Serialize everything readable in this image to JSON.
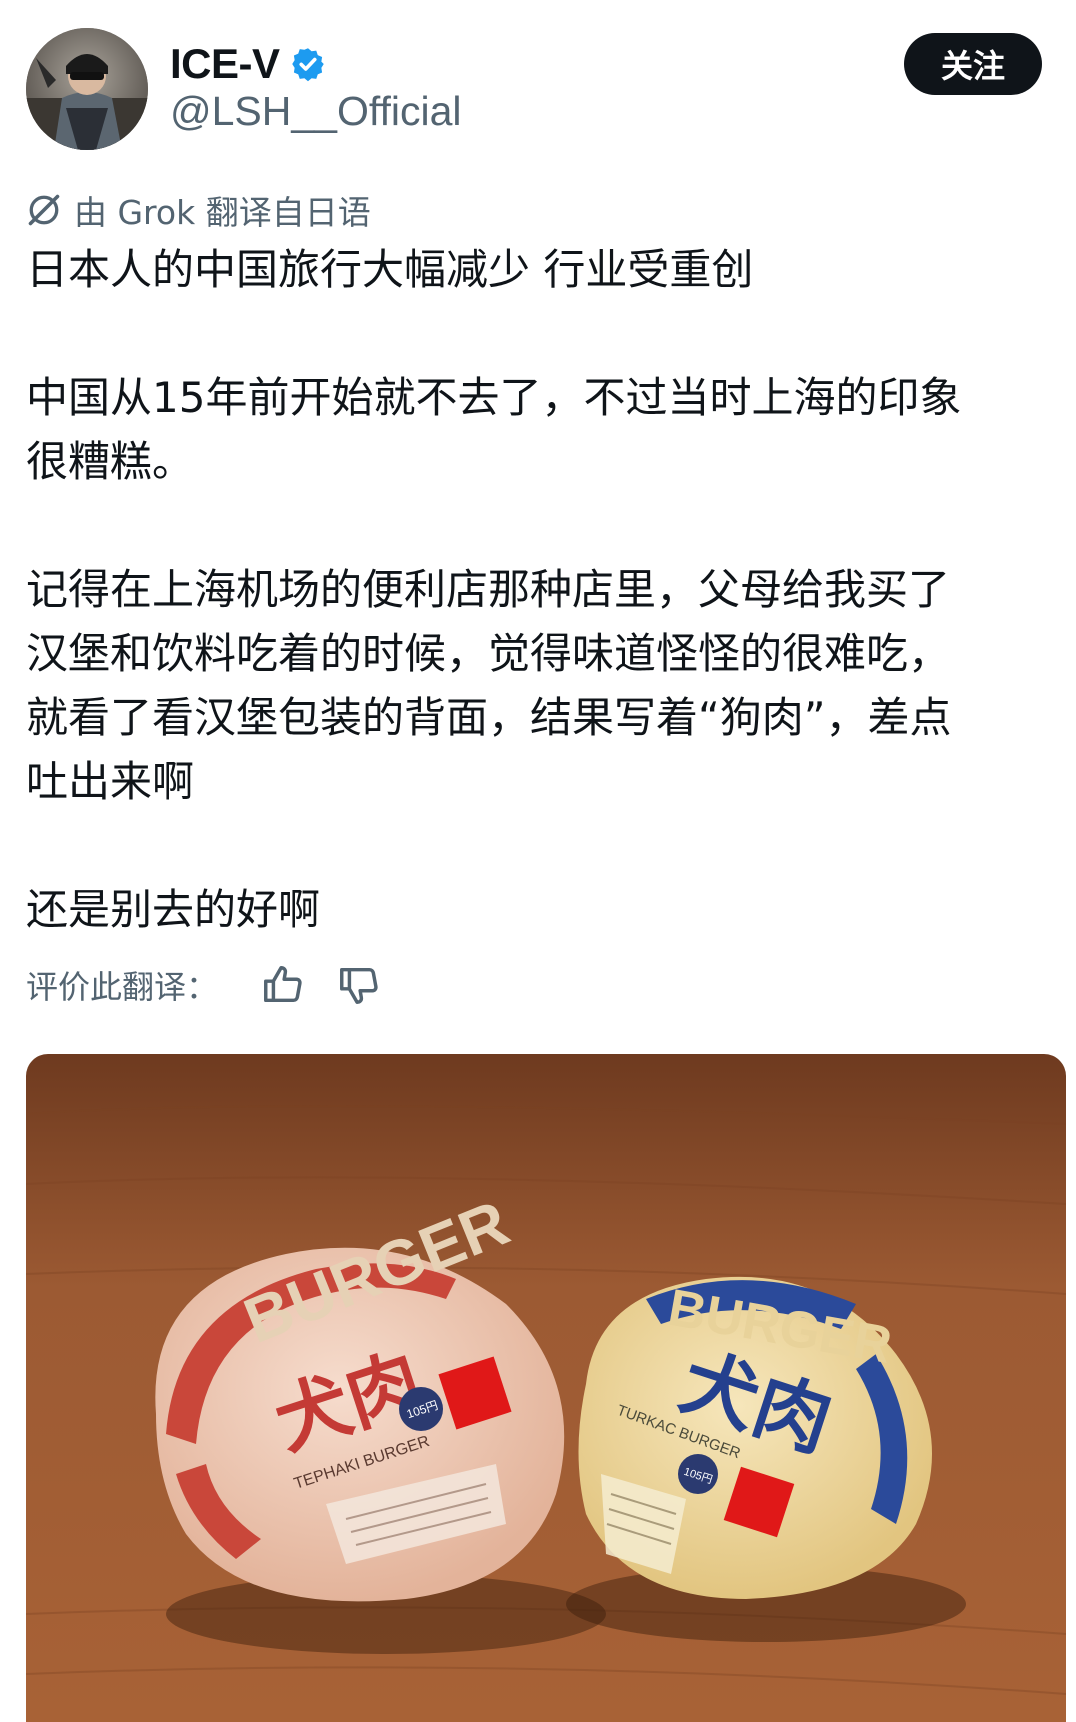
{
  "author": {
    "display_name": "ICE-V",
    "handle": "@LSH__Official",
    "avatar_icon": "avatar-photo",
    "verified_icon": "verified-badge-icon"
  },
  "follow_button": {
    "label": "关注"
  },
  "translation_note": {
    "icon": "grok-icon",
    "text": "由 Grok 翻译自日语"
  },
  "post": {
    "lines": [
      "日本人的中国旅行大幅减少 行业受重创",
      "中国从15年前开始就不去了，不过当时上海的印象",
      "很糟糕。",
      "记得在上海机场的便利店那种店里，父母给我买了",
      "汉堡和饮料吃着的时候，觉得味道怪怪的很难吃，",
      "就看了看汉堡包装的背面，结果写着“狗肉”，差点",
      "吐出来啊",
      "还是别去的好啊"
    ]
  },
  "rate_translation": {
    "label": "评价此翻译：",
    "like_icon": "thumbs-up-icon",
    "dislike_icon": "thumbs-down-icon"
  },
  "media": {
    "left_burger": {
      "brand": "BURGER",
      "kanji": "犬肉",
      "sub_name": "TEPHAKI BURGER",
      "price": "105円"
    },
    "right_burger": {
      "brand": "BURGER",
      "kanji": "犬肉",
      "sub_name": "TURKAC BURGER",
      "price": "105円"
    }
  },
  "colors": {
    "follow_bg": "#0f1419",
    "verified_blue": "#1d9bf0",
    "secondary_text": "#536471",
    "table_wood": "#9a5530",
    "left_wrap": "#ecc7b2",
    "right_wrap": "#eed9a2",
    "censor_red": "#e01818"
  }
}
